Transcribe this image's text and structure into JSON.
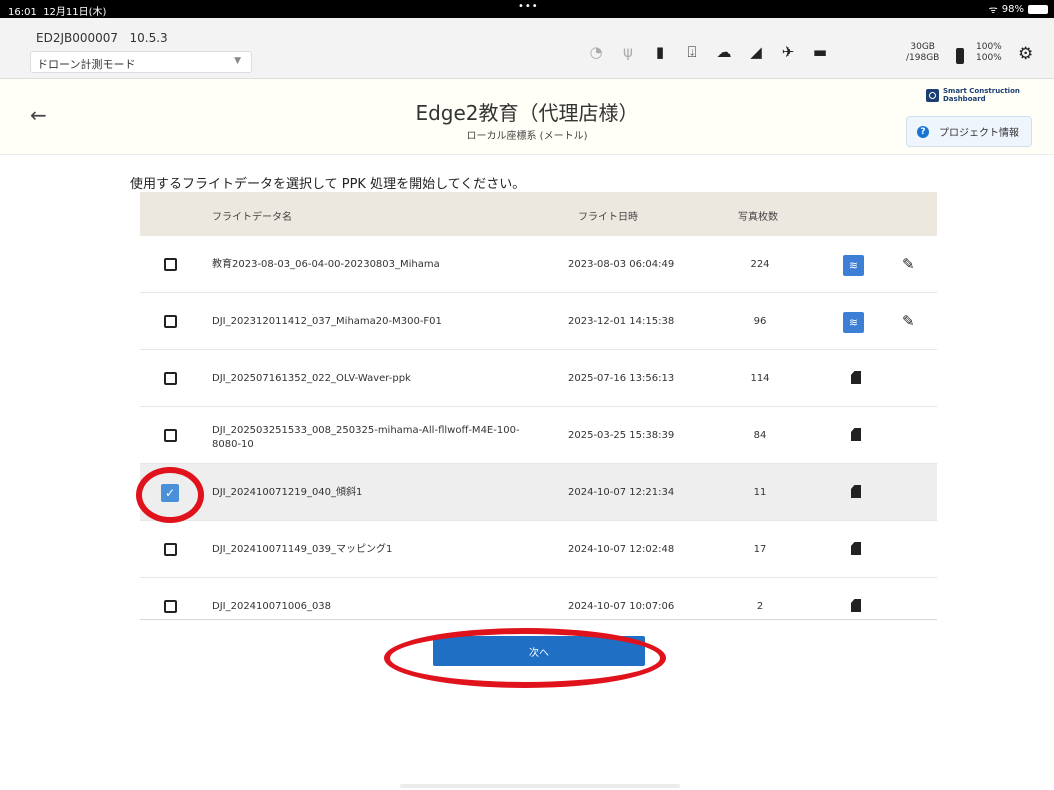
{
  "status_bar": {
    "time": "16:01",
    "date": "12月11日(木)",
    "dots": "•••",
    "wifi": "ᯤ",
    "battery": "98%"
  },
  "device": {
    "id": "ED2JB000007",
    "version": "10.5.3",
    "mode": "ドローン計測モード",
    "storage_used": "30GB",
    "storage_total": "/198GB",
    "battery1": "100%",
    "battery2": "100%"
  },
  "header": {
    "back_icon": "←",
    "title": "Edge2教育（代理店様）",
    "subtitle": "ローカル座標系 (メートル)",
    "logo_line1": "Smart Construction",
    "logo_line2": "Dashboard",
    "project_info_label": "プロジェクト情報",
    "help_icon": "?"
  },
  "instruction": "使用するフライトデータを選択して PPK 処理を開始してください。",
  "table": {
    "headers": {
      "name": "フライトデータ名",
      "datetime": "フライト日時",
      "photos": "写真枚数"
    },
    "rows": [
      {
        "name": "教育2023-08-03_06-04-00-20230803_Mihama",
        "datetime": "2023-08-03 06:04:49",
        "photos": "224",
        "checked": false,
        "icon": "database-icon",
        "editable": true
      },
      {
        "name": "DJI_202312011412_037_Mihama20-M300-F01",
        "datetime": "2023-12-01 14:15:38",
        "photos": "96",
        "checked": false,
        "icon": "database-icon",
        "editable": true
      },
      {
        "name": "DJI_202507161352_022_OLV-Waver-ppk",
        "datetime": "2025-07-16 13:56:13",
        "photos": "114",
        "checked": false,
        "icon": "sd-card-icon",
        "editable": false
      },
      {
        "name": "DJI_202503251533_008_250325-mihama-All-fllwoff-M4E-100-8080-10",
        "datetime": "2025-03-25 15:38:39",
        "photos": "84",
        "checked": false,
        "icon": "sd-card-icon",
        "editable": false
      },
      {
        "name": "DJI_202410071219_040_傾斜1",
        "datetime": "2024-10-07 12:21:34",
        "photos": "11",
        "checked": true,
        "icon": "sd-card-icon",
        "editable": false
      },
      {
        "name": "DJI_202410071149_039_マッピング1",
        "datetime": "2024-10-07 12:02:48",
        "photos": "17",
        "checked": false,
        "icon": "sd-card-icon",
        "editable": false
      },
      {
        "name": "DJI_202410071006_038",
        "datetime": "2024-10-07 10:07:06",
        "photos": "2",
        "checked": false,
        "icon": "sd-card-icon",
        "editable": false
      }
    ]
  },
  "next_button": "次へ",
  "colors": {
    "primary": "#1f6fc5",
    "highlight_ring": "#e0121b",
    "header_bg": "#ece8e0"
  }
}
